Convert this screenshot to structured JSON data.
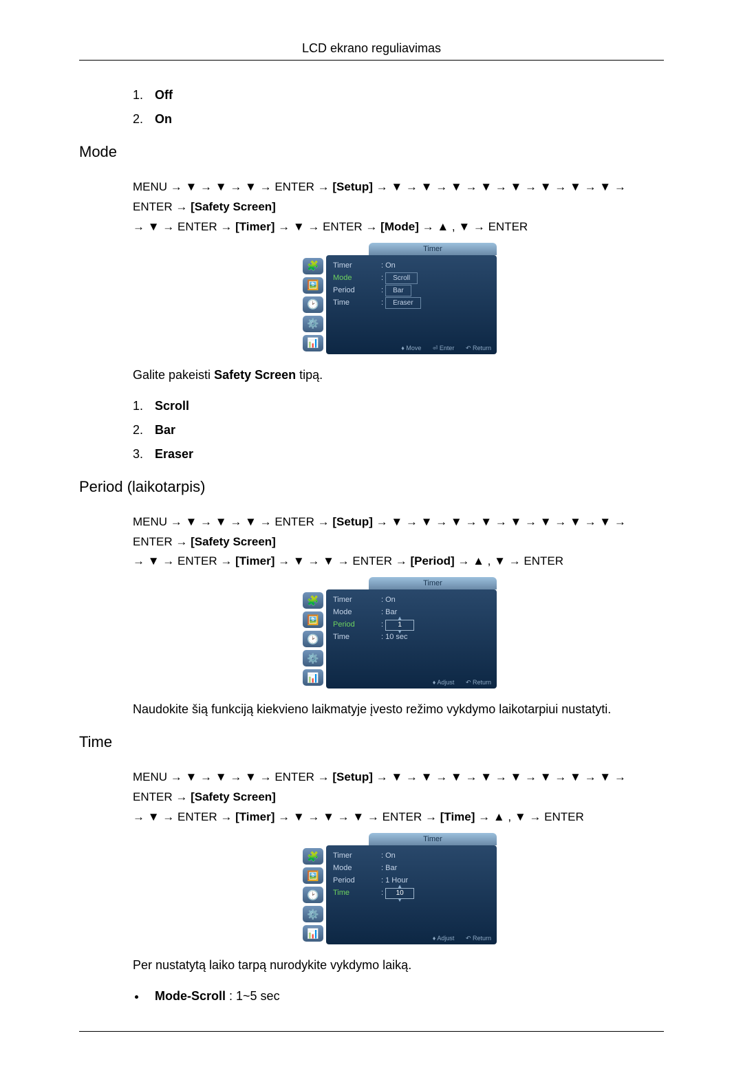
{
  "header": {
    "title": "LCD ekrano reguliavimas"
  },
  "offon": {
    "items": [
      "Off",
      "On"
    ]
  },
  "mode": {
    "heading": "Mode",
    "nav": {
      "line1_pre": "MENU → ",
      "enter": " ENTER ",
      "setup": "[Setup]",
      "safety": "[Safety Screen]",
      "timer_tag": "[Timer]",
      "mode_tag": "[Mode]",
      "down3": " → ▼ → ▼ → ▼ → ",
      "down8": " → ▼ → ▼ → ▼ → ▼ → ▼ → ▼ → ▼ → ▼ → ",
      "down1": " → ▼ → ",
      "updown_end": " → ▲ , ▼ → ENTER"
    },
    "osd": {
      "title": "Timer",
      "rows": [
        {
          "label": "Timer",
          "value": ": On",
          "sel": false
        },
        {
          "label": "Mode",
          "value": "",
          "sel": true,
          "dropdown": [
            "Scroll",
            "Bar",
            "Eraser"
          ]
        },
        {
          "label": "Period",
          "value": "",
          "sel": false,
          "hidden_list": true
        },
        {
          "label": "Time",
          "value": "",
          "sel": false
        }
      ],
      "foot": [
        "♦ Move",
        "⏎ Enter",
        "↶ Return"
      ]
    },
    "desc_pre": "Galite pakeisti ",
    "desc_bold": "Safety Screen",
    "desc_post": " tipą.",
    "options": [
      "Scroll",
      "Bar",
      "Eraser"
    ]
  },
  "period": {
    "heading": "Period (laikotarpis)",
    "nav_tag": "[Period]",
    "osd": {
      "title": "Timer",
      "rows": [
        {
          "label": "Timer",
          "value": ": On"
        },
        {
          "label": "Mode",
          "value": ": Bar"
        },
        {
          "label": "Period",
          "value": "1",
          "sel": true,
          "spin": true
        },
        {
          "label": "Time",
          "value": ": 10 sec"
        }
      ],
      "foot": [
        "♦ Adjust",
        "↶ Return"
      ]
    },
    "desc": "Naudokite šią funkciją kiekvieno laikmatyje įvesto režimo vykdymo laikotarpiui nustatyti."
  },
  "time": {
    "heading": "Time",
    "nav_tag": "[Time]",
    "osd": {
      "title": "Timer",
      "rows": [
        {
          "label": "Timer",
          "value": ": On"
        },
        {
          "label": "Mode",
          "value": ": Bar"
        },
        {
          "label": "Period",
          "value": ": 1 Hour"
        },
        {
          "label": "Time",
          "value": "10",
          "sel": true,
          "spin": true
        }
      ],
      "foot": [
        "♦ Adjust",
        "↶ Return"
      ]
    },
    "desc": "Per nustatytą laiko tarpą nurodykite vykdymo laiką.",
    "bullet_bold": "Mode-Scroll",
    "bullet_rest": " : 1~5 sec"
  }
}
